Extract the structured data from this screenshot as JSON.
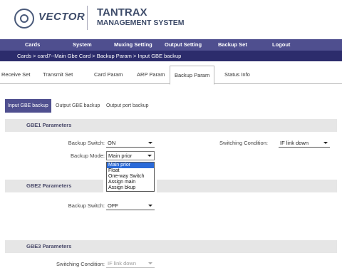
{
  "header": {
    "logo_text": "VECTOR",
    "brand_line1": "TANTRAX",
    "brand_line2": "MANAGEMENT SYSTEM"
  },
  "menu": [
    "Cards",
    "System",
    "Muxing Setting",
    "Output Setting",
    "Backup Set",
    "Logout"
  ],
  "breadcrumb": "Cards > card7--Main Gbe Card > Backup Param > Input GBE backup",
  "tabs": [
    {
      "label": "Receive Set"
    },
    {
      "label": "Transmit Set"
    },
    {
      "label": "Card Param"
    },
    {
      "label": "ARP Param"
    },
    {
      "label": "Backup Param",
      "active": true
    },
    {
      "label": "Status Info"
    }
  ],
  "subtabs": [
    {
      "label": "Input GBE backup",
      "active": true
    },
    {
      "label": "Output GBE backup"
    },
    {
      "label": "Output port backup"
    }
  ],
  "gbe1": {
    "title": "GBE1 Parameters",
    "backup_switch_label": "Backup Switch:",
    "backup_switch_value": "ON",
    "switching_condition_label": "Switching Condition:",
    "switching_condition_value": "IF link down",
    "backup_mode_label": "Backup Mode:",
    "backup_mode_value": "Main prior",
    "backup_mode_options": [
      "Main prior",
      "Float",
      "One-way Switch",
      "Assign main",
      "Assign bkup"
    ]
  },
  "gbe2": {
    "title": "GBE2 Parameters",
    "backup_switch_label": "Backup Switch:",
    "backup_switch_value": "OFF"
  },
  "gbe3": {
    "title": "GBE3 Parameters",
    "switching_condition_label": "Switching Condition:",
    "switching_condition_value": "IF link down"
  },
  "colors": {
    "menubar": "#4f4f8f",
    "breadcrumb": "#2c2c6c",
    "selected_option": "#2a6ad8"
  }
}
